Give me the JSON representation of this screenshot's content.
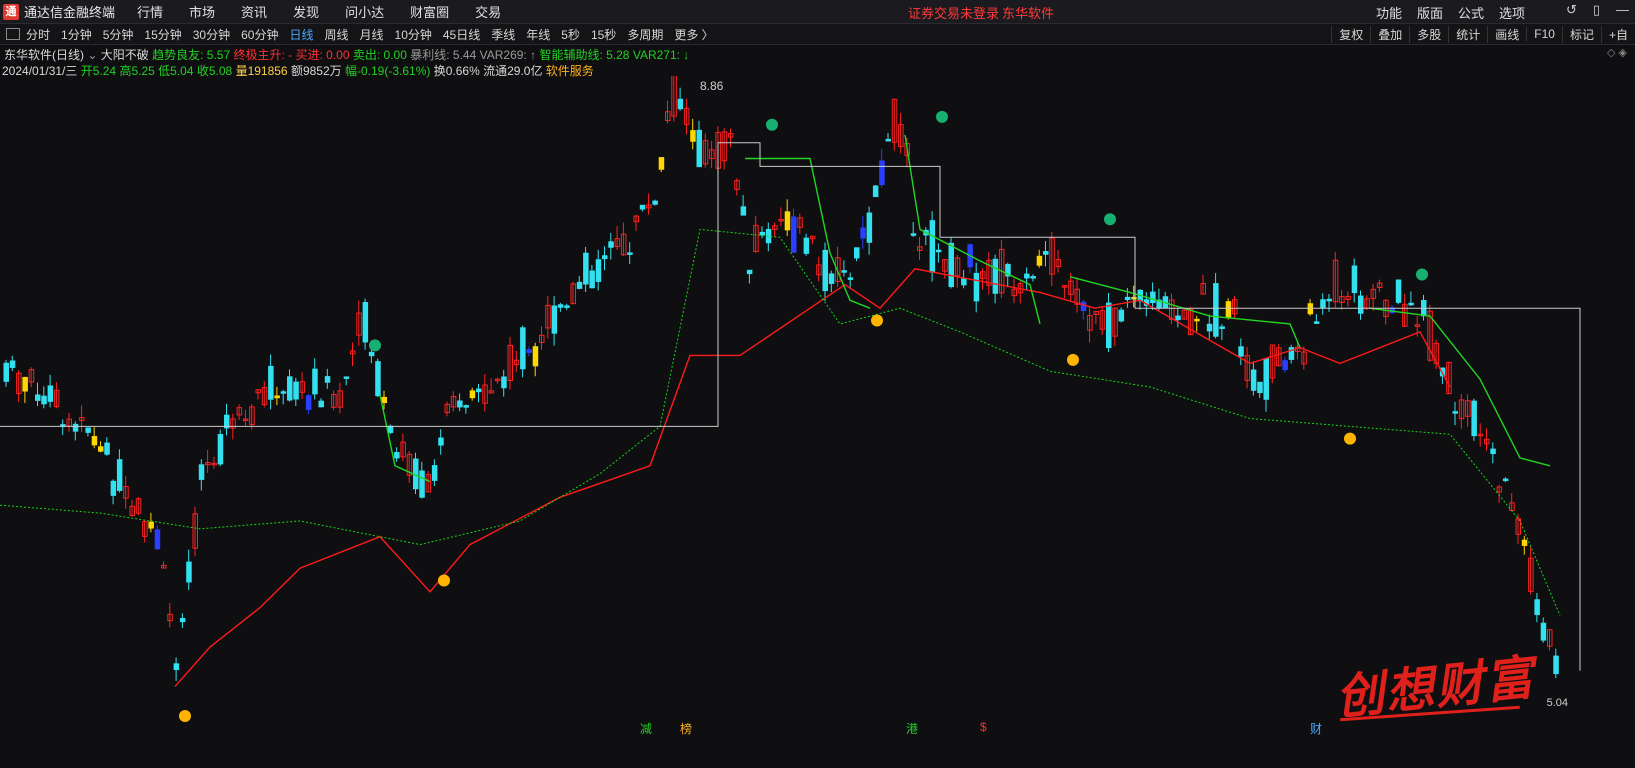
{
  "app": {
    "title": "通达信金融终端",
    "logo_letter": "通"
  },
  "menu": [
    "行情",
    "市场",
    "资讯",
    "发现",
    "问小达",
    "财富圈",
    "交易"
  ],
  "notice": {
    "login": "证券交易未登录",
    "stock": "东华软件"
  },
  "right_menu": [
    "功能",
    "版面",
    "公式",
    "选项"
  ],
  "window_controls": [
    "↺",
    "▯",
    "—"
  ],
  "periods": [
    "分时",
    "1分钟",
    "5分钟",
    "15分钟",
    "30分钟",
    "60分钟",
    "日线",
    "周线",
    "月线",
    "10分钟",
    "45日线",
    "季线",
    "年线",
    "5秒",
    "15秒",
    "多周期",
    "更多 〉"
  ],
  "active_period": "日线",
  "right_tools": [
    "复权",
    "叠加",
    "多股",
    "统计",
    "画线",
    "F10",
    "标记",
    "+自"
  ],
  "indicator_line": {
    "name": "东华软件(日线)",
    "formula": "大阳不破",
    "trend_label": "趋势良友: 5.57",
    "final_label": "终极主升: -",
    "buy_label": "买进: 0.00",
    "sell_label": "卖出: 0.00",
    "profit_label": "暴利线: 5.44",
    "var269": "VAR269: ↑",
    "assist_label": "智能辅助线: 5.28",
    "var271": "VAR271: ↓"
  },
  "quote_line": {
    "date": "2024/01/31/三",
    "open": "开5.24",
    "high": "高5.25",
    "low": "低5.04",
    "close": "收5.08",
    "volume": "量191856",
    "amount": "额9852万",
    "change": "幅-0.19(-3.61%)",
    "turnover": "换0.66%",
    "float_cap": "流通29.0亿",
    "sector": "软件服务"
  },
  "chart_data": {
    "type": "candlestick",
    "high_label": "8.86",
    "low_label": "5.04",
    "bottom_markers": [
      "减",
      "榜",
      "港",
      "$",
      "财"
    ],
    "colors": {
      "up": "#ff2020",
      "down": "#33e0f0",
      "cross": "#ffd700",
      "limit": "#2a3fff",
      "red_line": "#ff1a1a",
      "green_line": "#21d521",
      "dotted": "#18d418",
      "box": "#cccccc"
    }
  },
  "watermark": "创想财富"
}
